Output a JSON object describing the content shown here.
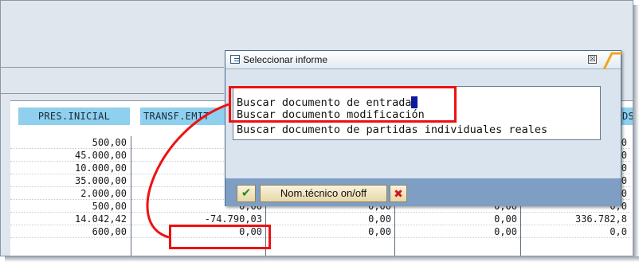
{
  "dialog": {
    "title": "Seleccionar informe",
    "close_glyph": "☒",
    "items": [
      "Buscar documento de entrada",
      "Buscar documento modificación",
      "Buscar documento de partidas individuales reales"
    ],
    "buttons": {
      "confirm_glyph": "✔",
      "tech_name": "Nom.técnico on/off",
      "cancel_glyph": "✖"
    }
  },
  "table": {
    "headers": [
      "PRES.INICIAL",
      "TRANSF.EMIT",
      "",
      "",
      "DS"
    ],
    "columns": [
      [
        "500,00",
        "45.000,00",
        "10.000,00",
        "35.000,00",
        "2.000,00",
        "500,00",
        "14.042,42",
        "600,00"
      ],
      [
        "",
        "",
        "",
        "",
        "",
        "0,00",
        "-74.790,03",
        "0,00"
      ],
      [
        "",
        "",
        "",
        "",
        "",
        "0,00",
        "0,00",
        "0,00"
      ],
      [
        "",
        "",
        "",
        "",
        "",
        "0,00",
        "0,00",
        "0,00"
      ],
      [
        ",0",
        ",0",
        ",0",
        ",0",
        ",0",
        "0,0",
        "336.782,8",
        "0,0"
      ]
    ]
  },
  "colors": {
    "accent": "#ee1111",
    "header_bg": "#8fd0ef",
    "footer_bg": "#7f9ec4"
  }
}
